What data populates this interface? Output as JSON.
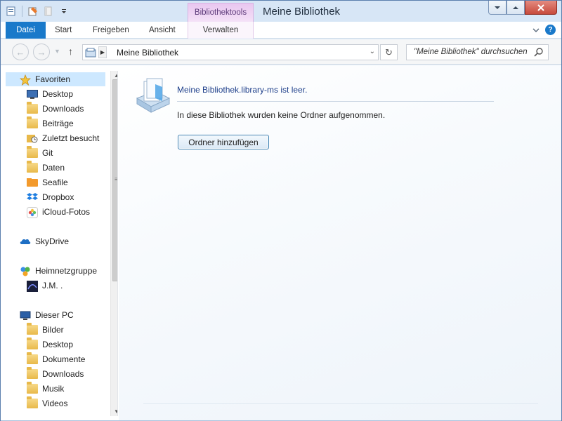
{
  "window": {
    "title": "Meine Bibliothek",
    "context_tab_group": "Bibliothektools"
  },
  "quick_access": {
    "icons": [
      "properties-icon",
      "new-folder-icon",
      "undo-icon",
      "customize-dropdown-icon"
    ]
  },
  "ribbon": {
    "tabs": [
      {
        "label": "Datei"
      },
      {
        "label": "Start"
      },
      {
        "label": "Freigeben"
      },
      {
        "label": "Ansicht"
      },
      {
        "label": "Verwalten"
      }
    ]
  },
  "address": {
    "path": "Meine Bibliothek"
  },
  "search": {
    "placeholder": "\"Meine Bibliothek\" durchsuchen"
  },
  "nav": {
    "favorites": {
      "label": "Favoriten",
      "items": [
        {
          "label": "Desktop",
          "icon": "desktop-icon"
        },
        {
          "label": "Downloads",
          "icon": "downloads-folder-icon"
        },
        {
          "label": "Beiträge",
          "icon": "folder-icon"
        },
        {
          "label": "Zuletzt besucht",
          "icon": "recent-places-icon"
        },
        {
          "label": "Git",
          "icon": "folder-icon"
        },
        {
          "label": "Daten",
          "icon": "folder-icon"
        },
        {
          "label": "Seafile",
          "icon": "seafile-folder-icon"
        },
        {
          "label": "Dropbox",
          "icon": "dropbox-icon"
        },
        {
          "label": "iCloud-Fotos",
          "icon": "icloud-photos-icon"
        }
      ]
    },
    "skydrive": {
      "label": "SkyDrive"
    },
    "homegroup": {
      "label": "Heimnetzgruppe",
      "items": [
        {
          "label": "J.M. .",
          "icon": "user-avatar-icon"
        }
      ]
    },
    "this_pc": {
      "label": "Dieser PC",
      "items": [
        {
          "label": "Bilder",
          "icon": "pictures-folder-icon"
        },
        {
          "label": "Desktop",
          "icon": "desktop-folder-icon"
        },
        {
          "label": "Dokumente",
          "icon": "documents-folder-icon"
        },
        {
          "label": "Downloads",
          "icon": "downloads-folder-icon"
        },
        {
          "label": "Musik",
          "icon": "music-folder-icon"
        },
        {
          "label": "Videos",
          "icon": "videos-folder-icon"
        }
      ]
    }
  },
  "main": {
    "empty_title": "Meine Bibliothek.library-ms ist leer.",
    "empty_desc": "In diese Bibliothek wurden keine Ordner aufgenommen.",
    "add_folder_button": "Ordner hinzufügen"
  },
  "colors": {
    "accent": "#1979ca",
    "selection": "#cde8ff",
    "context_tab": "#e9c6f0",
    "link_text": "#1e3f8a"
  }
}
